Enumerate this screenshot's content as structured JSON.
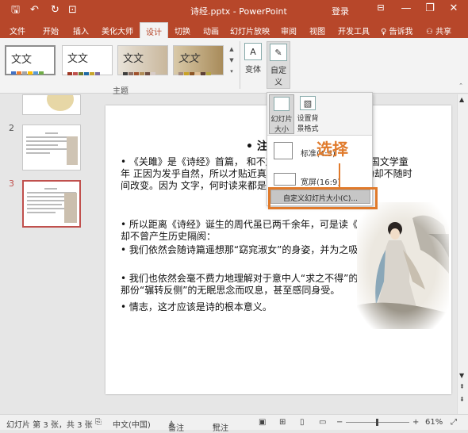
{
  "window": {
    "title": "诗经.pptx - PowerPoint",
    "login": "登录",
    "minimize": "—",
    "restore": "❐",
    "close": "✕"
  },
  "quick_access": {
    "save": "🖫",
    "undo": "↶",
    "redo": "↻",
    "present": "⊡"
  },
  "tabs": [
    {
      "label": "文件"
    },
    {
      "label": "开始"
    },
    {
      "label": "插入"
    },
    {
      "label": "美化大师"
    },
    {
      "label": "设计"
    },
    {
      "label": "切换"
    },
    {
      "label": "动画"
    },
    {
      "label": "幻灯片放映"
    },
    {
      "label": "审阅"
    },
    {
      "label": "视图"
    },
    {
      "label": "开发工具"
    },
    {
      "label": "告诉我"
    },
    {
      "label": "共享"
    }
  ],
  "ribbon": {
    "themes": [
      {
        "text": "文文",
        "colors": [
          "#4472c4",
          "#ed7d31",
          "#a5a5a5",
          "#ffc000",
          "#5b9bd5",
          "#70ad47",
          "#264478"
        ]
      },
      {
        "text": "文文",
        "colors": [
          "#9e3a26",
          "#c0504d",
          "#6b7a2a",
          "#1f6aa5",
          "#c7a52c",
          "#7c6c9e",
          "#2b2b2b"
        ]
      },
      {
        "text": "文文",
        "colors": [
          "#3f3f3f",
          "#8d6e63",
          "#a0522d",
          "#b08d57",
          "#6d4c41",
          "#d7ccc8",
          "#4e342e"
        ]
      },
      {
        "text": "文文",
        "colors": [
          "#a1887f",
          "#c9a227",
          "#8d5524",
          "#e0c097",
          "#5d4037",
          "#b5a642",
          "#3e2723"
        ]
      }
    ],
    "group_label": "主题",
    "variant_label": "变体",
    "customize_label": "自定义"
  },
  "dropdown": {
    "slide_size_label": "幻灯片大小",
    "format_bg_label": "设置背景格式",
    "standard_label": "标准(4:3)",
    "wide_label": "宽屏(16:9)",
    "custom_label": "自定义幻灯片大小(C)..."
  },
  "annotation": "选择",
  "thumbnails": [
    {
      "num": "2"
    },
    {
      "num": "3"
    }
  ],
  "slide": {
    "title": "• 注",
    "p1": "•   《关雎》是《诗经》首篇，                    和不加掩饰的情思，它具有中国文学童年                      正因为发乎自然，所以才贴近真实、直指                       它带给人的感动却不随时间改变。因为                    文字，何时读来都是没有障碍的。",
    "p2": "•   所以距离《诗经》诞生的周代虽已两千余年，可是读《关雎》时，却不曾产生历史隔阂：",
    "p3": "•   我们依然会随诗篇遥想那“窈窕淑女”的身姿，并为之吸引；",
    "p4": "•   我们也依然会毫不费力地理解对于意中人“求之不得”的辛苦，并为那份“辗转反侧”的无眠思念而叹息，甚至感同身受。",
    "p5": "•   情志，这才应该是诗的根本意义。"
  },
  "statusbar": {
    "slide_info": "幻灯片 第 3 张，共 3 张",
    "language": "中文(中国)",
    "notes": "备注",
    "comments": "批注",
    "zoom": "61%"
  }
}
